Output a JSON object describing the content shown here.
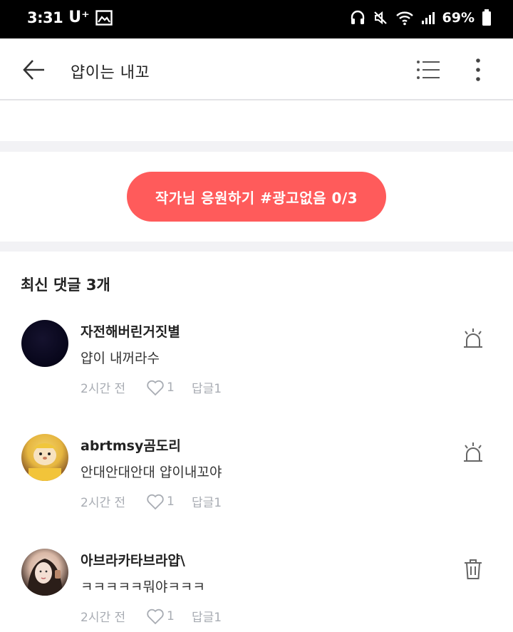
{
  "status_bar": {
    "time": "3:31",
    "carrier": "U⁺",
    "battery": "69%"
  },
  "app_bar": {
    "title": "얍이는 내꼬"
  },
  "support_button": {
    "label": "작가님 응원하기 #광고없음 0/3"
  },
  "comments_header": "최신 댓글 3개",
  "comments": [
    {
      "author": "자전해버린거짓별",
      "text": "얍이 내꺼라수",
      "time": "2시간 전",
      "likes": "1",
      "reply_label": "답글1",
      "action_icon": "report-siren-icon"
    },
    {
      "author": "abrtmsy곰도리",
      "text": "안대안대안대 얍이내꼬야",
      "time": "2시간 전",
      "likes": "1",
      "reply_label": "답글1",
      "action_icon": "report-siren-icon"
    },
    {
      "author": "아브라카타브라얍\\",
      "text": "ㅋㅋㅋㅋㅋ뭐야ㅋㅋㅋ",
      "time": "2시간 전",
      "likes": "1",
      "reply_label": "답글1",
      "action_icon": "trash-icon"
    }
  ],
  "colors": {
    "accent": "#ff5b5b",
    "divider": "#f2f2f5",
    "meta_text": "#a8acb3"
  }
}
